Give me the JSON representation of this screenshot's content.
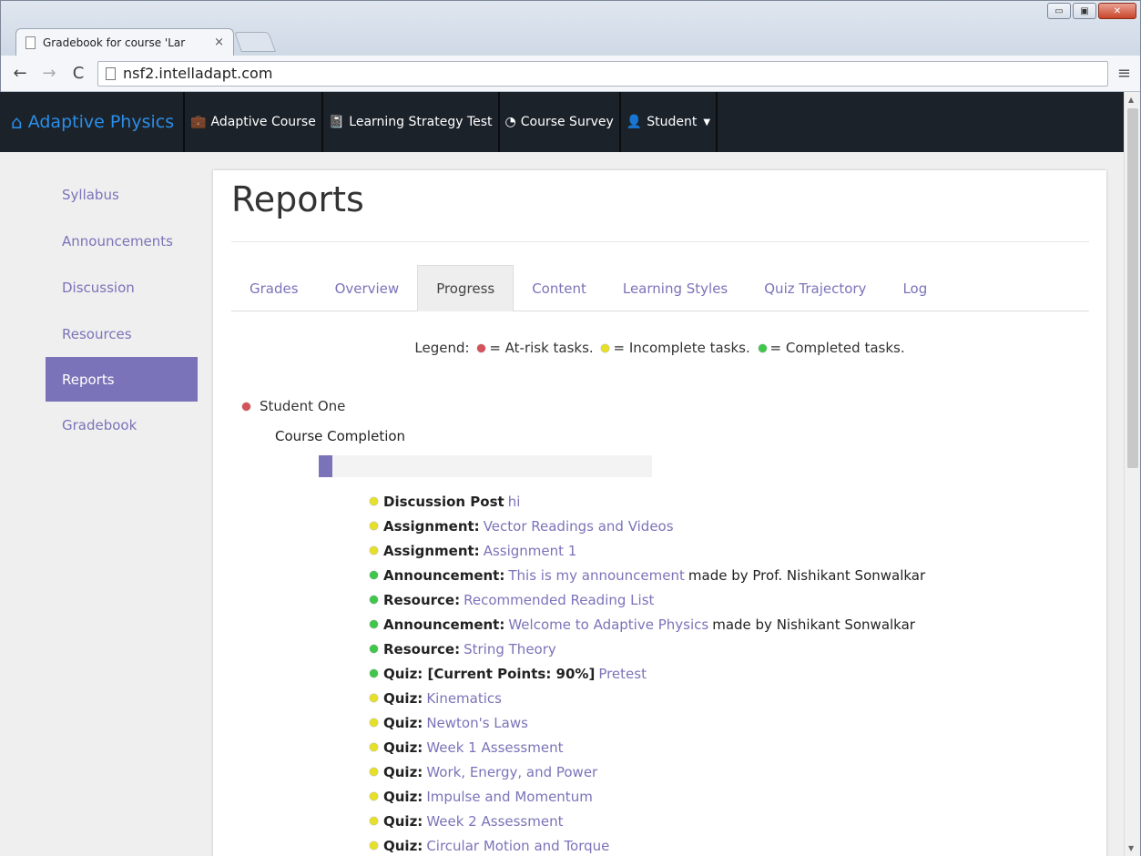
{
  "browser": {
    "tab_title": "Gradebook for course 'Lar",
    "tab_close": "×",
    "url": "nsf2.intelladapt.com",
    "window_buttons": {
      "minimize": "▭",
      "maximize": "▣",
      "close": "✕"
    }
  },
  "navbar": {
    "brand": "Adaptive Physics",
    "items": [
      {
        "label": "Adaptive Course",
        "icon": "briefcase-icon",
        "glyph": "💼"
      },
      {
        "label": "Learning Strategy Test",
        "icon": "book-icon",
        "glyph": "📓"
      },
      {
        "label": "Course Survey",
        "icon": "dashboard-icon",
        "glyph": "◔"
      },
      {
        "label": "Student",
        "icon": "user-icon",
        "glyph": "👤"
      }
    ]
  },
  "sidebar": {
    "items": [
      {
        "label": "Syllabus",
        "active": false
      },
      {
        "label": "Announcements",
        "active": false
      },
      {
        "label": "Discussion",
        "active": false
      },
      {
        "label": "Resources",
        "active": false
      },
      {
        "label": "Reports",
        "active": true
      },
      {
        "label": "Gradebook",
        "active": false
      }
    ]
  },
  "main": {
    "title": "Reports",
    "tabs": [
      "Grades",
      "Overview",
      "Progress",
      "Content",
      "Learning Styles",
      "Quiz Trajectory",
      "Log"
    ],
    "active_tab": "Progress",
    "legend": {
      "prefix": "Legend:",
      "at_risk": "= At-risk tasks.",
      "incomplete": "= Incomplete tasks.",
      "completed": "= Completed tasks."
    },
    "student": "Student One",
    "course_completion_label": "Course Completion",
    "course_completion_fraction": 0.04,
    "tasks": [
      {
        "status": "yellow",
        "type": "Discussion Post",
        "link": "hi",
        "suffix": ""
      },
      {
        "status": "yellow",
        "type": "Assignment:",
        "link": "Vector Readings and Videos",
        "suffix": ""
      },
      {
        "status": "yellow",
        "type": "Assignment:",
        "link": "Assignment 1",
        "suffix": ""
      },
      {
        "status": "green",
        "type": "Announcement:",
        "link": "This is my announcement",
        "suffix": "made by Prof. Nishikant Sonwalkar"
      },
      {
        "status": "green",
        "type": "Resource:",
        "link": "Recommended Reading List",
        "suffix": ""
      },
      {
        "status": "green",
        "type": "Announcement:",
        "link": "Welcome to Adaptive Physics",
        "suffix": "made by Nishikant Sonwalkar"
      },
      {
        "status": "green",
        "type": "Resource:",
        "link": "String Theory",
        "suffix": ""
      },
      {
        "status": "green",
        "type": "Quiz: [Current Points: 90%]",
        "link": "Pretest",
        "suffix": ""
      },
      {
        "status": "yellow",
        "type": "Quiz:",
        "link": "Kinematics",
        "suffix": ""
      },
      {
        "status": "yellow",
        "type": "Quiz:",
        "link": "Newton's Laws",
        "suffix": ""
      },
      {
        "status": "yellow",
        "type": "Quiz:",
        "link": "Week 1 Assessment",
        "suffix": ""
      },
      {
        "status": "yellow",
        "type": "Quiz:",
        "link": "Work, Energy, and Power",
        "suffix": ""
      },
      {
        "status": "yellow",
        "type": "Quiz:",
        "link": "Impulse and Momentum",
        "suffix": ""
      },
      {
        "status": "yellow",
        "type": "Quiz:",
        "link": "Week 2 Assessment",
        "suffix": ""
      },
      {
        "status": "yellow",
        "type": "Quiz:",
        "link": "Circular Motion and Torque",
        "suffix": ""
      }
    ]
  },
  "colors": {
    "accent": "#7b73b9",
    "brand": "#2a8ee8",
    "navbar": "#1c222a",
    "red": "#d6525a",
    "yellow": "#e6e128",
    "green": "#41c64c"
  }
}
